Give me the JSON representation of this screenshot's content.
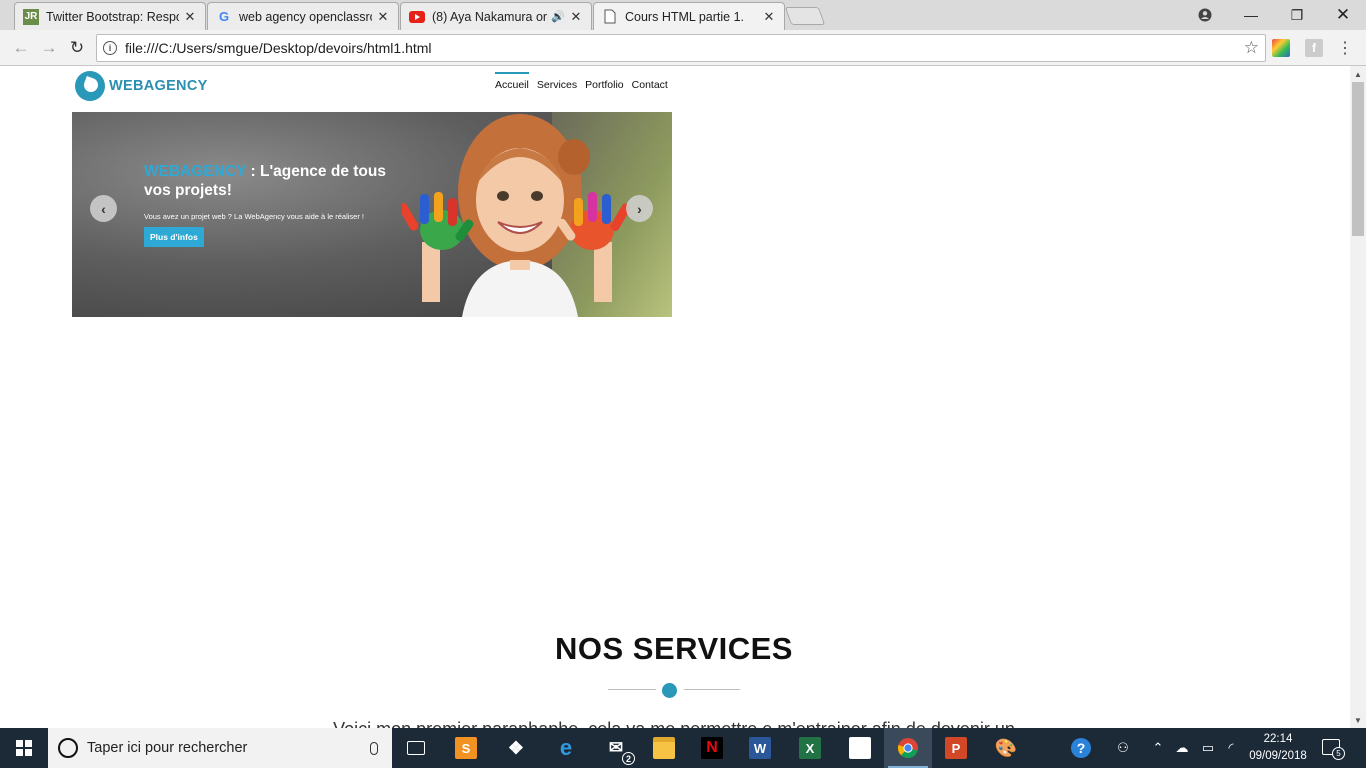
{
  "browser": {
    "tabs": [
      {
        "title": "Twitter Bootstrap: Respor",
        "favicon": "JR",
        "active": false
      },
      {
        "title": "web agency openclassroo",
        "favicon": "G",
        "active": false
      },
      {
        "title": "(8) Aya Nakamura orp",
        "favicon": "youtube-icon",
        "active": false,
        "audio": true
      },
      {
        "title": "Cours HTML partie 1.",
        "favicon": "page-icon",
        "active": true
      }
    ],
    "address": "file:///C:/Users/smgue/Desktop/devoirs/html1.html"
  },
  "site": {
    "logo_text": "WEBAGENCY",
    "nav": [
      "Accueil",
      "Services",
      "Portfolio",
      "Contact"
    ],
    "nav_active": "Accueil",
    "hero": {
      "title_brand": "WEBAGENCY",
      "title_rest": " : L'agence de tous vos projets!",
      "subtitle": "Vous avez un projet web ? La WebAgency vous aide à le réaliser !",
      "button": "Plus d'infos"
    },
    "services_title": "NOS SERVICES",
    "services_text": "Voici mon premier paraphaphe, cela va me permettre e m'entrainer afin de devenir un"
  },
  "taskbar": {
    "search_placeholder": "Taper ici pour rechercher",
    "mail_badge": "2",
    "time": "22:14",
    "date": "09/09/2018",
    "notifications": "5"
  },
  "colors": {
    "accent": "#2a98b8",
    "hero_brand": "#2ea9d6",
    "taskbar": "#1c2a38"
  }
}
